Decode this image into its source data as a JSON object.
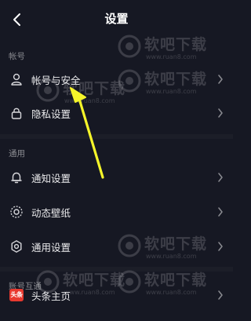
{
  "header": {
    "title": "设置",
    "back_icon": "chevron-left-icon"
  },
  "sections": [
    {
      "title": "帐号",
      "items": [
        {
          "label": "帐号与安全",
          "icon": "person-icon"
        },
        {
          "label": "隐私设置",
          "icon": "lock-icon"
        }
      ]
    },
    {
      "title": "通用",
      "items": [
        {
          "label": "通知设置",
          "icon": "bell-icon"
        },
        {
          "label": "动态壁纸",
          "icon": "live-wallpaper-icon"
        },
        {
          "label": "通用设置",
          "icon": "gear-icon"
        }
      ]
    },
    {
      "title": "账号互通",
      "items": [
        {
          "label": "头条主页",
          "icon": "toutiao-logo-icon",
          "badge_text": "头条"
        }
      ]
    }
  ],
  "watermark": {
    "text": "软吧下载",
    "url": "www.ruan8.com"
  },
  "colors": {
    "background": "#161823",
    "divider": "#1c1e28",
    "section_header": "#8a8b91",
    "annotation_arrow": "#f5f52a",
    "toutiao_badge": "#e8392f"
  }
}
